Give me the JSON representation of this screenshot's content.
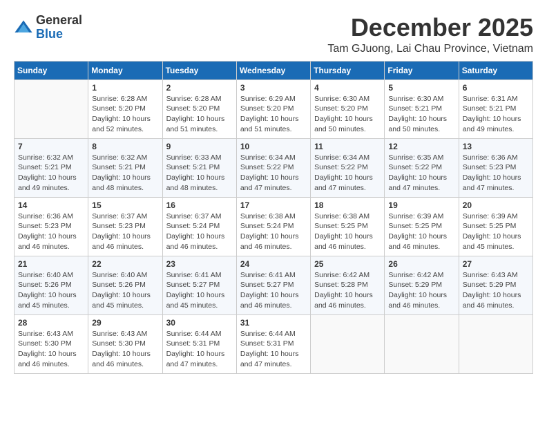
{
  "header": {
    "logo_general": "General",
    "logo_blue": "Blue",
    "title": "December 2025",
    "subtitle": "Tam GJuong, Lai Chau Province, Vietnam"
  },
  "days_of_week": [
    "Sunday",
    "Monday",
    "Tuesday",
    "Wednesday",
    "Thursday",
    "Friday",
    "Saturday"
  ],
  "weeks": [
    [
      {
        "day": "",
        "info": ""
      },
      {
        "day": "1",
        "info": "Sunrise: 6:28 AM\nSunset: 5:20 PM\nDaylight: 10 hours\nand 52 minutes."
      },
      {
        "day": "2",
        "info": "Sunrise: 6:28 AM\nSunset: 5:20 PM\nDaylight: 10 hours\nand 51 minutes."
      },
      {
        "day": "3",
        "info": "Sunrise: 6:29 AM\nSunset: 5:20 PM\nDaylight: 10 hours\nand 51 minutes."
      },
      {
        "day": "4",
        "info": "Sunrise: 6:30 AM\nSunset: 5:20 PM\nDaylight: 10 hours\nand 50 minutes."
      },
      {
        "day": "5",
        "info": "Sunrise: 6:30 AM\nSunset: 5:21 PM\nDaylight: 10 hours\nand 50 minutes."
      },
      {
        "day": "6",
        "info": "Sunrise: 6:31 AM\nSunset: 5:21 PM\nDaylight: 10 hours\nand 49 minutes."
      }
    ],
    [
      {
        "day": "7",
        "info": "Sunrise: 6:32 AM\nSunset: 5:21 PM\nDaylight: 10 hours\nand 49 minutes."
      },
      {
        "day": "8",
        "info": "Sunrise: 6:32 AM\nSunset: 5:21 PM\nDaylight: 10 hours\nand 48 minutes."
      },
      {
        "day": "9",
        "info": "Sunrise: 6:33 AM\nSunset: 5:21 PM\nDaylight: 10 hours\nand 48 minutes."
      },
      {
        "day": "10",
        "info": "Sunrise: 6:34 AM\nSunset: 5:22 PM\nDaylight: 10 hours\nand 47 minutes."
      },
      {
        "day": "11",
        "info": "Sunrise: 6:34 AM\nSunset: 5:22 PM\nDaylight: 10 hours\nand 47 minutes."
      },
      {
        "day": "12",
        "info": "Sunrise: 6:35 AM\nSunset: 5:22 PM\nDaylight: 10 hours\nand 47 minutes."
      },
      {
        "day": "13",
        "info": "Sunrise: 6:36 AM\nSunset: 5:23 PM\nDaylight: 10 hours\nand 47 minutes."
      }
    ],
    [
      {
        "day": "14",
        "info": "Sunrise: 6:36 AM\nSunset: 5:23 PM\nDaylight: 10 hours\nand 46 minutes."
      },
      {
        "day": "15",
        "info": "Sunrise: 6:37 AM\nSunset: 5:23 PM\nDaylight: 10 hours\nand 46 minutes."
      },
      {
        "day": "16",
        "info": "Sunrise: 6:37 AM\nSunset: 5:24 PM\nDaylight: 10 hours\nand 46 minutes."
      },
      {
        "day": "17",
        "info": "Sunrise: 6:38 AM\nSunset: 5:24 PM\nDaylight: 10 hours\nand 46 minutes."
      },
      {
        "day": "18",
        "info": "Sunrise: 6:38 AM\nSunset: 5:25 PM\nDaylight: 10 hours\nand 46 minutes."
      },
      {
        "day": "19",
        "info": "Sunrise: 6:39 AM\nSunset: 5:25 PM\nDaylight: 10 hours\nand 46 minutes."
      },
      {
        "day": "20",
        "info": "Sunrise: 6:39 AM\nSunset: 5:25 PM\nDaylight: 10 hours\nand 45 minutes."
      }
    ],
    [
      {
        "day": "21",
        "info": "Sunrise: 6:40 AM\nSunset: 5:26 PM\nDaylight: 10 hours\nand 45 minutes."
      },
      {
        "day": "22",
        "info": "Sunrise: 6:40 AM\nSunset: 5:26 PM\nDaylight: 10 hours\nand 45 minutes."
      },
      {
        "day": "23",
        "info": "Sunrise: 6:41 AM\nSunset: 5:27 PM\nDaylight: 10 hours\nand 45 minutes."
      },
      {
        "day": "24",
        "info": "Sunrise: 6:41 AM\nSunset: 5:27 PM\nDaylight: 10 hours\nand 46 minutes."
      },
      {
        "day": "25",
        "info": "Sunrise: 6:42 AM\nSunset: 5:28 PM\nDaylight: 10 hours\nand 46 minutes."
      },
      {
        "day": "26",
        "info": "Sunrise: 6:42 AM\nSunset: 5:29 PM\nDaylight: 10 hours\nand 46 minutes."
      },
      {
        "day": "27",
        "info": "Sunrise: 6:43 AM\nSunset: 5:29 PM\nDaylight: 10 hours\nand 46 minutes."
      }
    ],
    [
      {
        "day": "28",
        "info": "Sunrise: 6:43 AM\nSunset: 5:30 PM\nDaylight: 10 hours\nand 46 minutes."
      },
      {
        "day": "29",
        "info": "Sunrise: 6:43 AM\nSunset: 5:30 PM\nDaylight: 10 hours\nand 46 minutes."
      },
      {
        "day": "30",
        "info": "Sunrise: 6:44 AM\nSunset: 5:31 PM\nDaylight: 10 hours\nand 47 minutes."
      },
      {
        "day": "31",
        "info": "Sunrise: 6:44 AM\nSunset: 5:31 PM\nDaylight: 10 hours\nand 47 minutes."
      },
      {
        "day": "",
        "info": ""
      },
      {
        "day": "",
        "info": ""
      },
      {
        "day": "",
        "info": ""
      }
    ]
  ]
}
